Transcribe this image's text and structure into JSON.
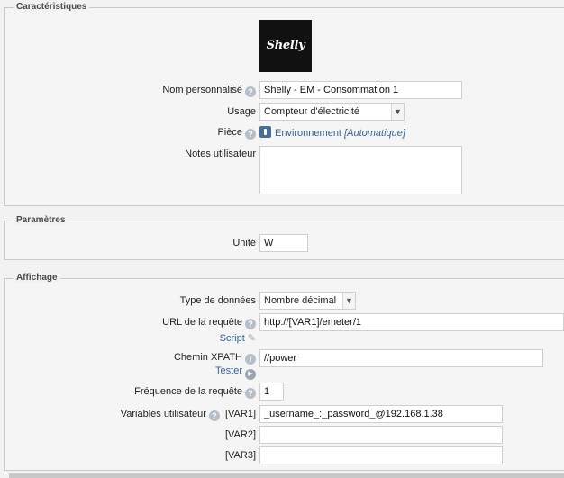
{
  "characteristics": {
    "legend": "Caractéristiques",
    "logo_text": "Shelly",
    "custom_name": {
      "label": "Nom personnalisé",
      "value": "Shelly - EM - Consommation 1"
    },
    "usage": {
      "label": "Usage",
      "value": "Compteur d'électricité"
    },
    "room": {
      "label": "Pièce",
      "value": "Environnement",
      "auto": "[Automatique]"
    },
    "notes": {
      "label": "Notes utilisateur",
      "value": ""
    }
  },
  "parameters": {
    "legend": "Paramètres",
    "unit": {
      "label": "Unité",
      "value": "W"
    }
  },
  "display": {
    "legend": "Affichage",
    "data_type": {
      "label": "Type de données",
      "value": "Nombre décimal"
    },
    "url": {
      "label": "URL de la requête",
      "value": "http://[VAR1]/emeter/1",
      "script_link": "Script"
    },
    "xpath": {
      "label": "Chemin XPATH",
      "value": "//power",
      "test_link": "Tester"
    },
    "frequency": {
      "label": "Fréquence de la requête",
      "value": "1"
    },
    "variables": {
      "label": "Variables utilisateur",
      "var1": {
        "label": "[VAR1]",
        "value": "_username_:_password_@192.168.1.38"
      },
      "var2": {
        "label": "[VAR2]",
        "value": ""
      },
      "var3": {
        "label": "[VAR3]",
        "value": ""
      }
    }
  },
  "icons": {
    "help": "question-circle-icon",
    "info": "info-circle-icon",
    "pencil": "pencil-icon",
    "play": "play-circle-icon",
    "room": "room-icon"
  },
  "colors": {
    "link": "#336699",
    "background": "#f2f2f2",
    "help_icon": "#b6bec8"
  }
}
